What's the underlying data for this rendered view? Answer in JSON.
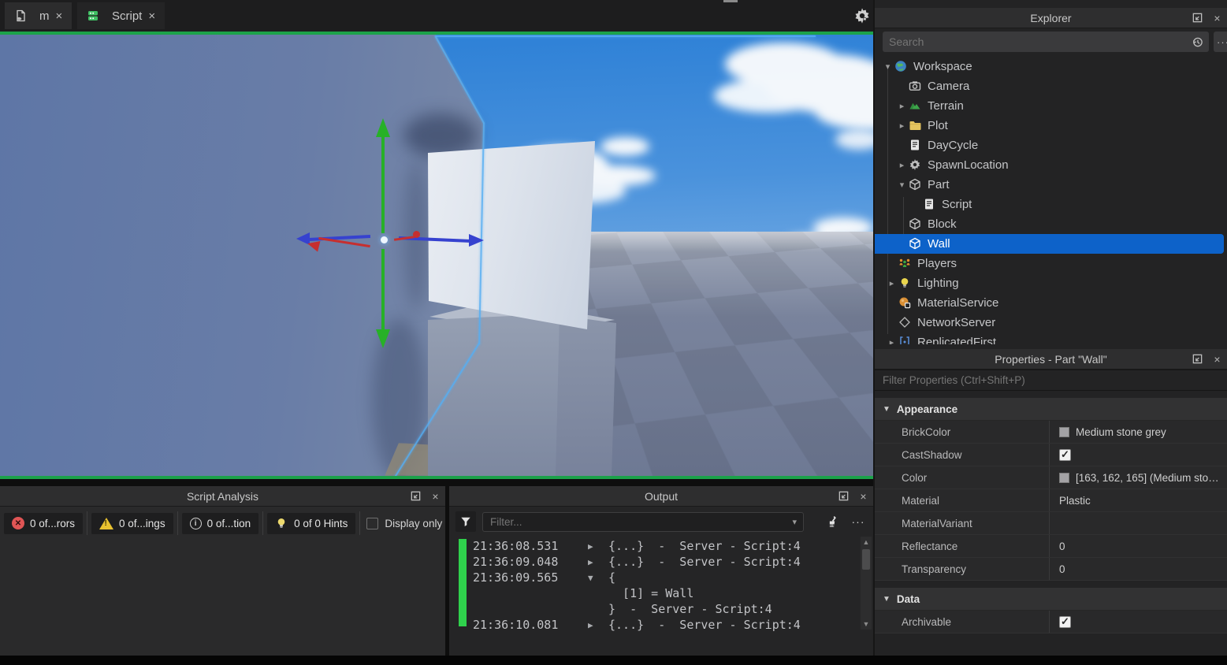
{
  "tabbar": {
    "tabs": [
      {
        "label": "m"
      },
      {
        "label": "Script"
      }
    ],
    "close_glyph": "×"
  },
  "explorer": {
    "title": "Explorer",
    "search": {
      "placeholder": "Search"
    },
    "more_label": "···",
    "tree": [
      {
        "label": "Workspace",
        "arrow": "▾",
        "icon": "workspace"
      },
      {
        "label": "Camera",
        "arrow": "",
        "icon": "camera"
      },
      {
        "label": "Terrain",
        "arrow": "▸",
        "icon": "terrain"
      },
      {
        "label": "Plot",
        "arrow": "▸",
        "icon": "folder"
      },
      {
        "label": "DayCycle",
        "arrow": "",
        "icon": "script"
      },
      {
        "label": "SpawnLocation",
        "arrow": "▸",
        "icon": "gear"
      },
      {
        "label": "Part",
        "arrow": "▾",
        "icon": "part"
      },
      {
        "label": "Script",
        "arrow": "",
        "icon": "script"
      },
      {
        "label": "Block",
        "arrow": "",
        "icon": "part"
      },
      {
        "label": "Wall",
        "arrow": "",
        "icon": "part",
        "selected": true
      },
      {
        "label": "Players",
        "arrow": "",
        "icon": "players"
      },
      {
        "label": "Lighting",
        "arrow": "▸",
        "icon": "lighting"
      },
      {
        "label": "MaterialService",
        "arrow": "",
        "icon": "material"
      },
      {
        "label": "NetworkServer",
        "arrow": "",
        "icon": "network"
      },
      {
        "label": "ReplicatedFirst",
        "arrow": "▸",
        "icon": "replicated"
      }
    ]
  },
  "properties": {
    "title": "Properties - Part \"Wall\"",
    "filter_placeholder": "Filter Properties (Ctrl+Shift+P)",
    "sections": [
      {
        "name": "Appearance",
        "arrow": "▼",
        "rows": [
          {
            "label": "BrickColor",
            "value": "Medium stone grey",
            "type": "swatch",
            "swatch": "#a3a2a5"
          },
          {
            "label": "CastShadow",
            "value": "",
            "type": "checkbox",
            "checked": true
          },
          {
            "label": "Color",
            "value": "[163, 162, 165] (Medium sto…",
            "type": "swatch",
            "swatch": "#a3a2a5"
          },
          {
            "label": "Material",
            "value": "Plastic",
            "type": "text"
          },
          {
            "label": "MaterialVariant",
            "value": "",
            "type": "text"
          },
          {
            "label": "Reflectance",
            "value": "0",
            "type": "text"
          },
          {
            "label": "Transparency",
            "value": "0",
            "type": "text"
          }
        ]
      },
      {
        "name": "Data",
        "arrow": "▼",
        "rows": [
          {
            "label": "Archivable",
            "value": "",
            "type": "checkbox",
            "checked": true
          }
        ]
      }
    ]
  },
  "script_analysis": {
    "title": "Script Analysis",
    "filters": [
      {
        "icon": "error-icon",
        "label": "0 of...rors"
      },
      {
        "icon": "warning-icon",
        "label": "0 of...ings"
      },
      {
        "icon": "info-icon",
        "label": "0 of...tion"
      },
      {
        "icon": "hint-icon",
        "label": "0 of 0 Hints"
      }
    ],
    "display_only_label": "Display only"
  },
  "output": {
    "title": "Output",
    "filter_placeholder": "Filter...",
    "logs": [
      {
        "time": "21:36:08.531",
        "expander": "▶",
        "text": "{...}  -  Server - Script:4"
      },
      {
        "time": "21:36:09.048",
        "expander": "▶",
        "text": "{...}  -  Server - Script:4"
      },
      {
        "time": "21:36:09.565",
        "expander": "▼",
        "text": "{"
      },
      {
        "time": "",
        "expander": "",
        "text": "  [1] = Wall"
      },
      {
        "time": "",
        "expander": "",
        "text": "}  -  Server - Script:4"
      },
      {
        "time": "21:36:10.081",
        "expander": "▶",
        "text": "{...}  -  Server - Script:4"
      }
    ]
  },
  "colors": {
    "selection_blue": "#0d62c9",
    "play_border_green": "#1ca24a",
    "output_marker_green": "#2fd14c",
    "selection_outline_cyan": "#56aef2",
    "brickcolor_swatch": "#a3a2a5"
  }
}
